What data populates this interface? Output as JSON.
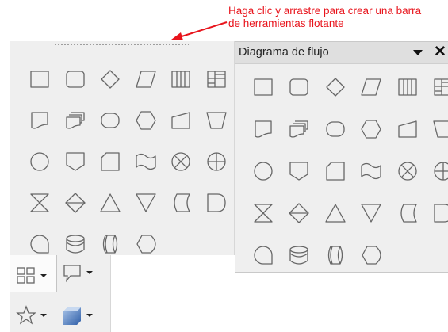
{
  "annotation": {
    "line1": "Haga clic y arrastre para crear una barra",
    "line2": "de herramientas flotante",
    "color": "#e8141c"
  },
  "left_toolbar": {
    "shapes": [
      "process",
      "alternate-process",
      "decision",
      "data",
      "predefined-process",
      "internal-storage",
      "document",
      "multidocument",
      "terminator",
      "preparation",
      "manual-input",
      "manual-operation",
      "connector",
      "off-page-connector",
      "card",
      "punched-tape",
      "summing-junction",
      "or",
      "collate",
      "sort",
      "extract",
      "merge",
      "stored-data",
      "delay",
      "sequential-access",
      "magnetic-disc",
      "direct-access-storage",
      "display"
    ]
  },
  "bottom_tabs": {
    "items": [
      {
        "name": "flowchart-tab",
        "icon": "flowchart-icon",
        "active": true
      },
      {
        "name": "callouts-tab",
        "icon": "callout-icon",
        "active": false
      },
      {
        "name": "stars-tab",
        "icon": "star-icon",
        "active": false
      },
      {
        "name": "3d-objects-tab",
        "icon": "cube-3d-icon",
        "active": false
      }
    ]
  },
  "flow_window": {
    "title": "Diagrama de flujo",
    "close_glyph": "✕",
    "shapes": [
      "process",
      "alternate-process",
      "decision",
      "data",
      "predefined-process",
      "internal-storage",
      "document",
      "multidocument",
      "terminator",
      "preparation",
      "manual-input",
      "manual-operation",
      "connector",
      "off-page-connector",
      "card",
      "punched-tape",
      "summing-junction",
      "or",
      "collate",
      "sort",
      "extract",
      "merge",
      "stored-data",
      "delay",
      "sequential-access",
      "magnetic-disc",
      "direct-access-storage",
      "display"
    ]
  }
}
